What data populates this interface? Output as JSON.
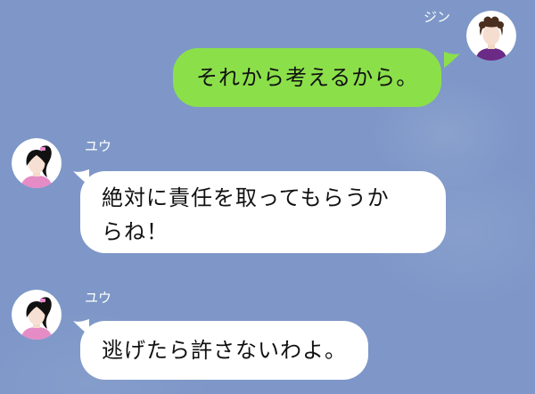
{
  "messages": [
    {
      "sender": "ジン",
      "text": "それから考えるから。"
    },
    {
      "sender": "ユウ",
      "lines": [
        "絶対に責任を取ってもらうか",
        "らね！"
      ]
    },
    {
      "sender": "ユウ",
      "text": "逃げたら許さないわよ。"
    }
  ],
  "colors": {
    "background": "#7e97c8",
    "outgoing_bubble": "#8be04a",
    "incoming_bubble": "#ffffff"
  },
  "icons": {
    "avatar_jin": "curly-hair-man-avatar-icon",
    "avatar_yuu": "ponytail-woman-avatar-icon"
  }
}
